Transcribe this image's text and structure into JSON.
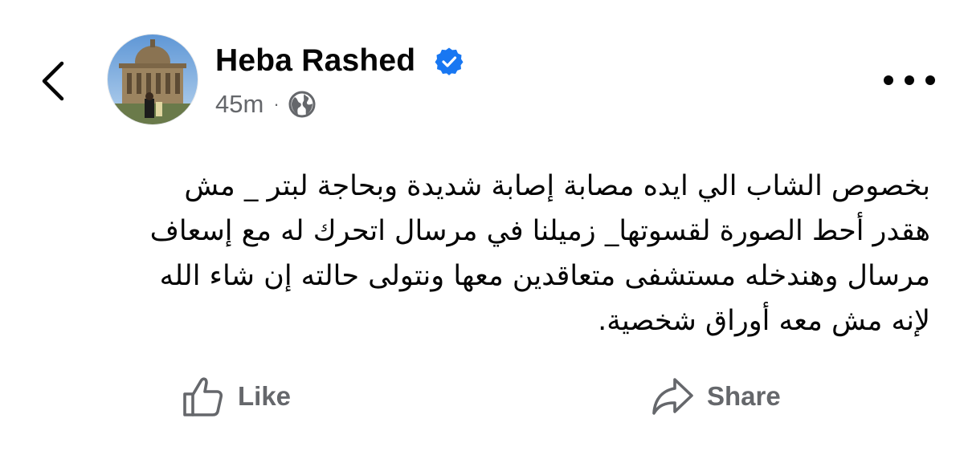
{
  "header": {
    "back_icon": "chevron-left-icon",
    "author_name": "Heba Rashed",
    "verified_icon": "verified-badge-icon",
    "timestamp": "45m",
    "separator": "·",
    "audience_icon": "globe-icon",
    "more_icon": "more-horizontal-icon"
  },
  "post": {
    "lines": [
      "بخصوص الشاب الي ايده مصابة إصابة شديدة وبحاجة لبتر _ مش",
      "هقدر أحط  الصورة لقسوتها_  زميلنا في مرسال اتحرك له مع إسعاف",
      "مرسال وهندخله مستشفى متعاقدين معها ونتولى  حالته إن شاء الله",
      "لإنه مش معه أوراق شخصية."
    ]
  },
  "actions": {
    "like_label": "Like",
    "like_icon": "thumbs-up-icon",
    "share_label": "Share",
    "share_icon": "share-arrow-icon"
  },
  "colors": {
    "text_primary": "#050505",
    "text_secondary": "#65676b",
    "verified_blue": "#1877f2",
    "background": "#ffffff"
  }
}
